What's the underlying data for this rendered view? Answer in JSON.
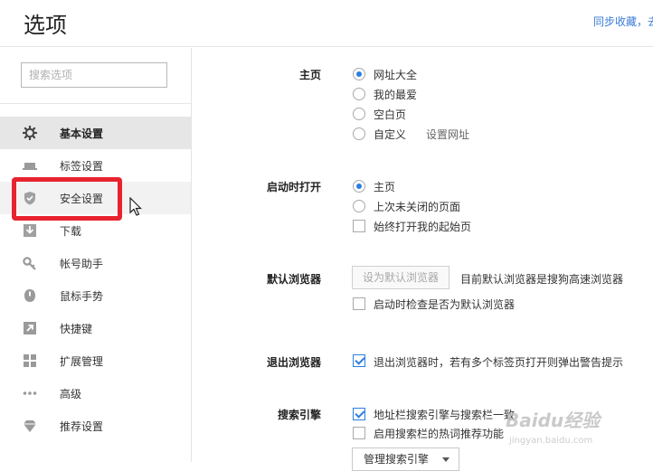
{
  "header": {
    "title": "选项",
    "sync_link": "同步收藏，去"
  },
  "sidebar": {
    "search_placeholder": "搜索选项",
    "items": [
      {
        "label": "基本设置",
        "icon": "gear-icon"
      },
      {
        "label": "标签设置",
        "icon": "tab-icon"
      },
      {
        "label": "安全设置",
        "icon": "shield-icon"
      },
      {
        "label": "下载",
        "icon": "download-icon"
      },
      {
        "label": "帐号助手",
        "icon": "key-icon"
      },
      {
        "label": "鼠标手势",
        "icon": "mouse-icon"
      },
      {
        "label": "快捷键",
        "icon": "shortcut-arrow-icon"
      },
      {
        "label": "扩展管理",
        "icon": "grid-icon"
      },
      {
        "label": "高级",
        "icon": "dots-icon"
      },
      {
        "label": "推荐设置",
        "icon": "diamond-icon"
      }
    ],
    "active_index": 0,
    "hover_index": 2
  },
  "main": {
    "homepage": {
      "label": "主页",
      "options": [
        "网址大全",
        "我的最爱",
        "空白页",
        "自定义"
      ],
      "selected": "网址大全",
      "set_url_link": "设置网址"
    },
    "startup": {
      "label": "启动时打开",
      "options": [
        "主页",
        "上次未关闭的页面"
      ],
      "selected": "主页",
      "always_open_checkbox": "始终打开我的起始页",
      "always_open_checked": false
    },
    "default_browser": {
      "label": "默认浏览器",
      "button": "设为默认浏览器",
      "status": "目前默认浏览器是搜狗高速浏览器",
      "check_on_start": "启动时检查是否为默认浏览器",
      "check_on_start_checked": false
    },
    "exit_browser": {
      "label": "退出浏览器",
      "warn_checkbox": "退出浏览器时，若有多个标签页打开则弹出警告提示",
      "warn_checked": true
    },
    "search_engine": {
      "label": "搜索引擎",
      "sync_checkbox": "地址栏搜索引擎与搜索栏一致",
      "sync_checked": true,
      "hot_checkbox": "启用搜索栏的热词推荐功能",
      "hot_checked": false,
      "manage_button": "管理搜索引擎"
    }
  },
  "watermark": {
    "brand": "Baidu经验",
    "url": "jingyan.baidu.com"
  },
  "colors": {
    "accent": "#2a7fe0",
    "highlight": "#e8232f",
    "link": "#3b7bd6"
  }
}
